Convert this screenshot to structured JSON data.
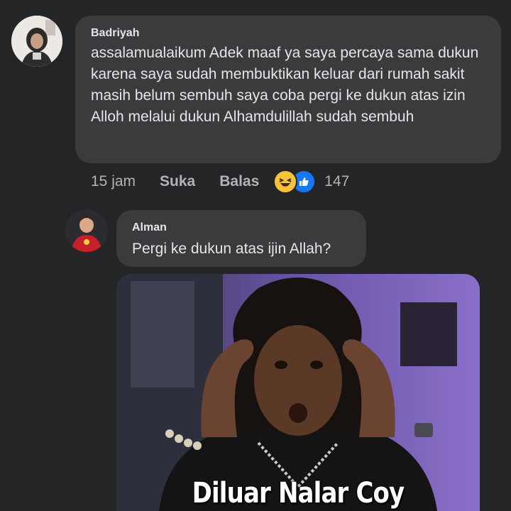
{
  "comments": [
    {
      "author": "Badriyah",
      "text": "assalamualaikum Adek maaf ya saya percaya sama dukun karena saya sudah membuktikan keluar dari rumah sakit masih belum sembuh saya coba pergi ke dukun atas izin Alloh melalui dukun Alhamdulillah sudah sembuh",
      "time": "15 jam",
      "like_label": "Suka",
      "reply_label": "Balas",
      "reaction_count": "147",
      "reactions": [
        "haha-icon",
        "like-icon"
      ]
    },
    {
      "author": "Alman",
      "text": "Pergi ke dukun atas ijin Allah?",
      "attachment": {
        "type": "meme-image",
        "caption": "Diluar Nalar Coy"
      }
    }
  ],
  "colors": {
    "background": "#242526",
    "bubble": "#3a3b3c",
    "text": "#e4e6eb",
    "secondary_text": "#b0b3b8",
    "like_blue": "#1877f2",
    "haha_yellow": "#f7c33b"
  }
}
